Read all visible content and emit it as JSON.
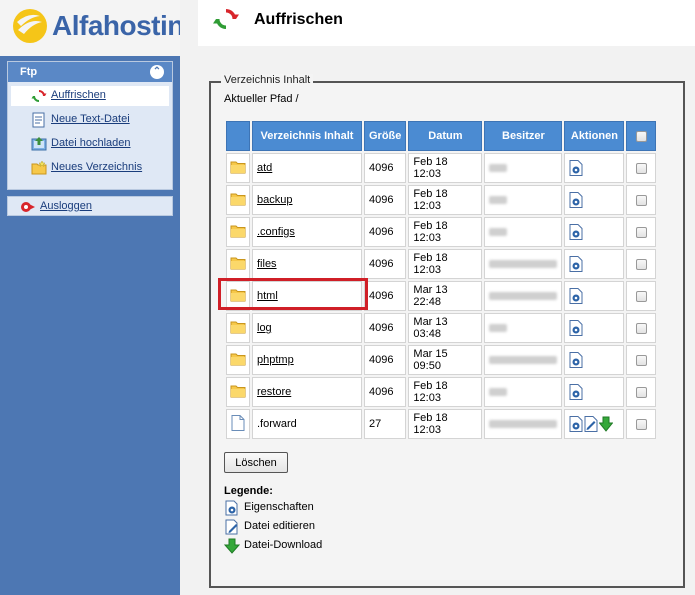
{
  "sidebar": {
    "logo_text": "Alfahosting",
    "section_title": "Ftp",
    "items": [
      {
        "label": "Auffrischen",
        "icon": "refresh-icon"
      },
      {
        "label": "Neue Text-Datei",
        "icon": "new-text-file-icon"
      },
      {
        "label": "Datei hochladen",
        "icon": "upload-icon"
      },
      {
        "label": "Neues Verzeichnis",
        "icon": "new-folder-icon"
      }
    ],
    "logout_label": "Ausloggen"
  },
  "header": {
    "title": "Auffrischen"
  },
  "panel": {
    "legend": "Verzeichnis Inhalt",
    "current_path": "Aktueller Pfad /"
  },
  "table": {
    "headers": [
      "Verzeichnis Inhalt",
      "Größe",
      "Datum",
      "Besitzer",
      "Aktionen"
    ],
    "rows": [
      {
        "name": "atd",
        "type": "folder",
        "size": "4096",
        "date": "Feb 18 12:03"
      },
      {
        "name": "backup",
        "type": "folder",
        "size": "4096",
        "date": "Feb 18 12:03"
      },
      {
        "name": ".configs",
        "type": "folder",
        "size": "4096",
        "date": "Feb 18 12:03"
      },
      {
        "name": "files",
        "type": "folder",
        "size": "4096",
        "date": "Feb 18 12:03"
      },
      {
        "name": "html",
        "type": "folder",
        "size": "4096",
        "date": "Mar 13 22:48"
      },
      {
        "name": "log",
        "type": "folder",
        "size": "4096",
        "date": "Mar 13 03:48"
      },
      {
        "name": "phptmp",
        "type": "folder",
        "size": "4096",
        "date": "Mar 15 09:50"
      },
      {
        "name": "restore",
        "type": "folder",
        "size": "4096",
        "date": "Feb 18 12:03"
      },
      {
        "name": ".forward",
        "type": "file",
        "size": "27",
        "date": "Feb 18 12:03"
      }
    ]
  },
  "delete_button": "Löschen",
  "legend_box": {
    "title": "Legende:",
    "items": [
      {
        "label": "Eigenschaften",
        "icon": "properties-icon"
      },
      {
        "label": "Datei editieren",
        "icon": "edit-file-icon"
      },
      {
        "label": "Datei-Download",
        "icon": "download-icon"
      }
    ]
  },
  "colors": {
    "sidebar": "#4d77b3",
    "table_header": "#4b8bd2",
    "highlight": "#d01f27"
  }
}
